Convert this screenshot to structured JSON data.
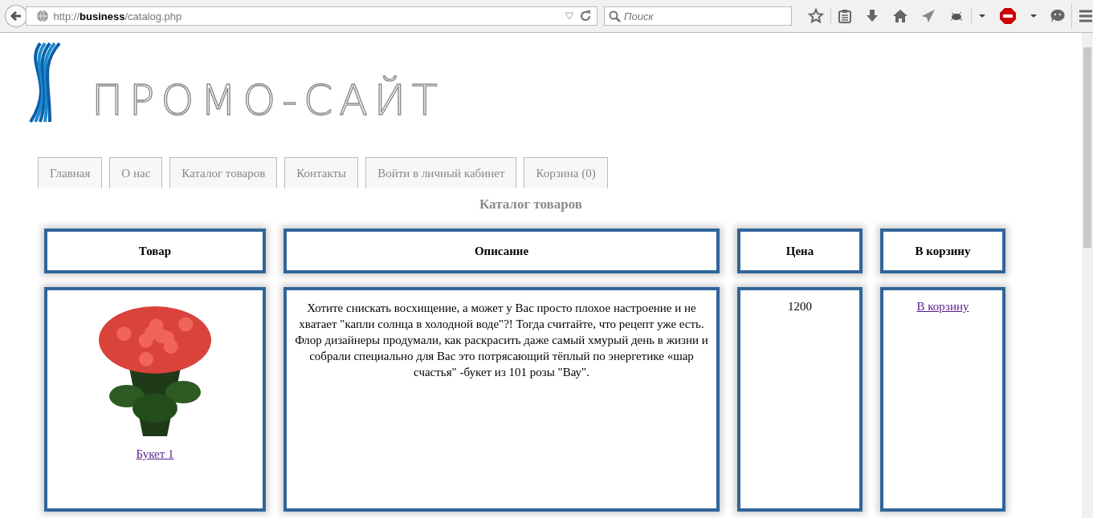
{
  "browser": {
    "url": "http://**business**/catalog.php",
    "search": {
      "placeholder": "Поиск"
    }
  },
  "site": {
    "logo_text": "ПРОМО-САЙТ",
    "tabs": [
      {
        "label": "Главная",
        "selected": false
      },
      {
        "label": "О нас",
        "selected": false
      },
      {
        "label": "Каталог товаров",
        "selected": false
      },
      {
        "label": "Контакты",
        "selected": false
      },
      {
        "label": "Войти в личный кабинет",
        "selected": false
      },
      {
        "label": "Корзина (0)",
        "selected": false
      }
    ],
    "heading": "Каталог товаров",
    "table": {
      "columns": [
        "Товар",
        "Описание",
        "Цена",
        "В корзину"
      ],
      "rows": [
        {
          "product": {
            "kind": "picture",
            "link": "Букет 1"
          },
          "description": "Хотите снискать восхищение, а может у Вас просто плохое настроение и не хватает \"капли солнца в холодной воде\"?! Тогда считайте, что рецепт уже есть. Флор дизайнеры продумали, как раскрасить даже самый хмурый день в жизни и собрали специально для Вас это потрясающий тёплый по энергетике «шар счастья\" -букет из 101 розы \"Вау\".",
          "price": "1200",
          "cart_link": "В корзину"
        }
      ]
    }
  }
}
